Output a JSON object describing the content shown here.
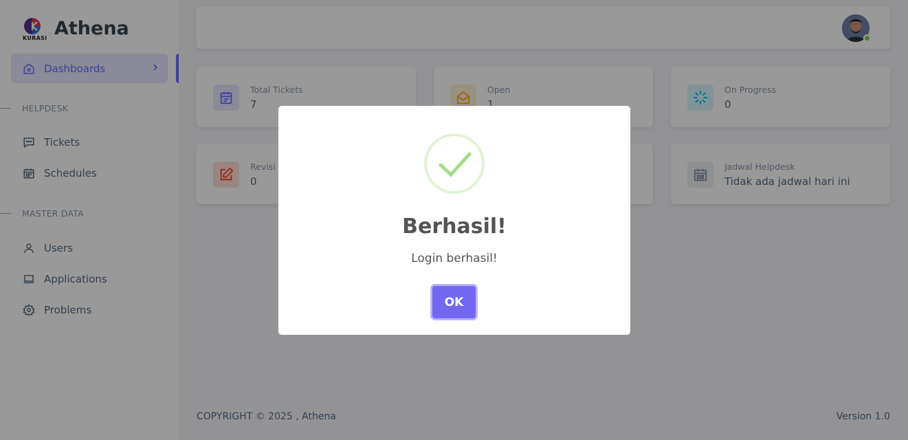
{
  "brand": {
    "name": "Athena",
    "logo_text": "KURASI"
  },
  "sidebar": {
    "active": {
      "label": "Dashboards"
    },
    "sections": [
      {
        "title": "HELPDESK",
        "items": [
          {
            "label": "Tickets",
            "icon": "message-square-icon"
          },
          {
            "label": "Schedules",
            "icon": "calendar-icon"
          }
        ]
      },
      {
        "title": "MASTER DATA",
        "items": [
          {
            "label": "Users",
            "icon": "user-icon"
          },
          {
            "label": "Applications",
            "icon": "laptop-icon"
          },
          {
            "label": "Problems",
            "icon": "gear-icon"
          }
        ]
      }
    ]
  },
  "cards": [
    {
      "title": "Total Tickets",
      "value": "7",
      "color": "#696cff",
      "icon": "calendar-icon"
    },
    {
      "title": "Open",
      "value": "1",
      "color": "#ffab00",
      "icon": "envelope-open-icon"
    },
    {
      "title": "On Progress",
      "value": "0",
      "color": "#03c3ec",
      "icon": "loader-icon"
    },
    {
      "title": "Revisi",
      "value": "0",
      "color": "#ff3e1d",
      "icon": "edit-icon"
    },
    {
      "title": "",
      "value": "",
      "color": "#71dd37",
      "icon": ""
    },
    {
      "title": "Jadwal Helpdesk",
      "value": "Tidak ada jadwal hari ini",
      "color": "#8592a3",
      "icon": "calendar-icon"
    }
  ],
  "footer": {
    "copyright": "COPYRIGHT © 2025 , Athena",
    "version": "Version 1.0"
  },
  "modal": {
    "title": "Berhasil!",
    "text": "Login berhasil!",
    "button": "OK"
  }
}
